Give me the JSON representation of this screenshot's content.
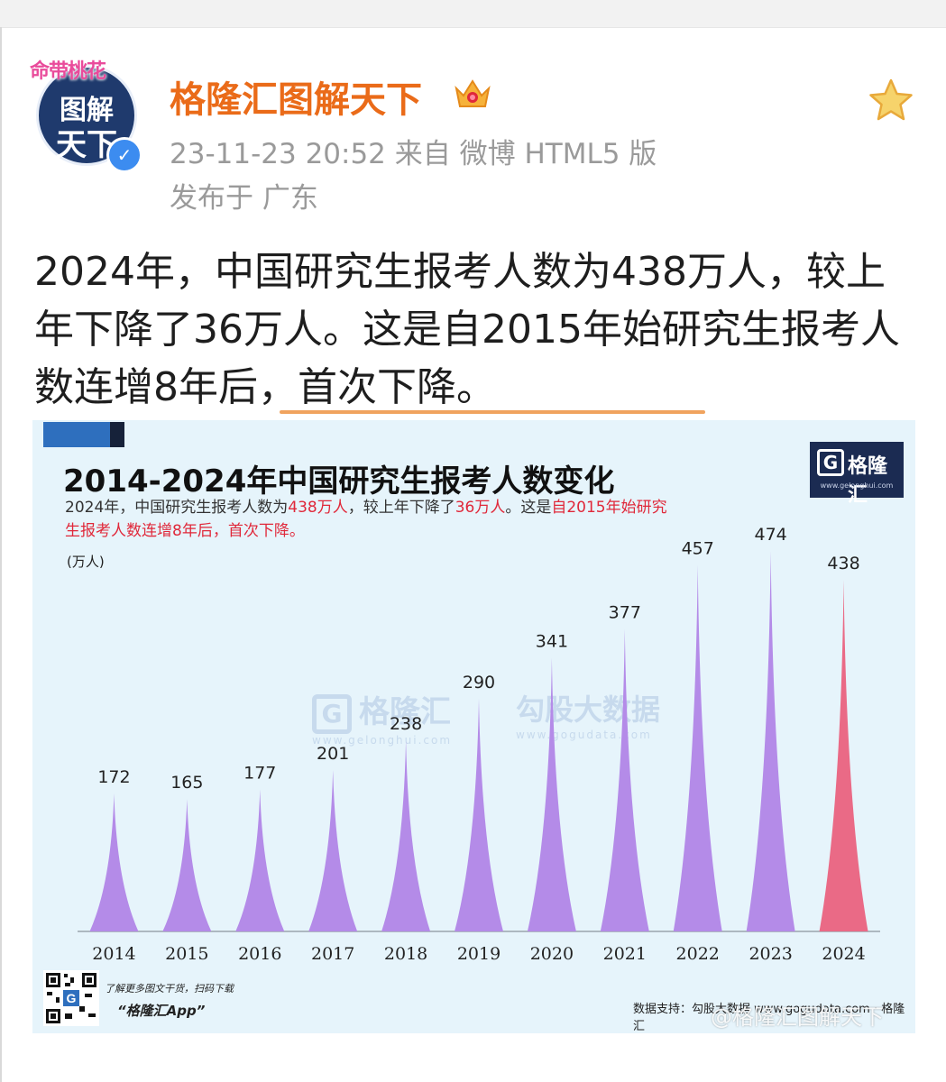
{
  "post": {
    "username": "格隆汇图解天下",
    "avatar_crown": "命带桃花",
    "avatar_line1": "图解",
    "avatar_line2": "天下",
    "verified_mark": "✓",
    "meta_line": "23-11-23 20:52   来自 微博 HTML5 版",
    "location": "发布于 广东",
    "text": "2024年，中国研究生报考人数为438万人，较上年下降了36万人。这是自2015年始研究生报考人数连增8年后，首次下降。"
  },
  "card": {
    "logo_mark": "G",
    "logo_name": "格隆汇",
    "logo_url": "www.gelonghui.com",
    "subtitle_parts": [
      "2024年，中国研究生报考人数为",
      "438万人",
      "，较上年下降了",
      "36万人",
      "。这是",
      "自2015年始研究生报考人数连增8年后，首次下降。"
    ],
    "unit": "(万人)",
    "watermark_left": "格隆汇",
    "watermark_left_url": "www.gelonghui.com",
    "watermark_right": "勾股大数据",
    "watermark_right_url": "www.gogudata.com",
    "qr_line1": "了解更多图文干货，扫码下载",
    "qr_line2": "“格隆汇App”",
    "source": "数据支持：勾股大数据 www.gogudata.com · 格隆汇"
  },
  "weibo_watermark": "@格隆汇图解天下",
  "colors": {
    "accent_orange": "#ea6b19",
    "bar_purple": "#b48be8",
    "bar_highlight": "#ea6a86",
    "highlight_red": "#e0283a"
  },
  "chart_data": {
    "type": "bar",
    "title": "2014-2024年中国研究生报考人数变化",
    "ylabel": "(万人)",
    "categories": [
      "2014",
      "2015",
      "2016",
      "2017",
      "2018",
      "2019",
      "2020",
      "2021",
      "2022",
      "2023",
      "2024"
    ],
    "values": [
      172,
      165,
      177,
      201,
      238,
      290,
      341,
      377,
      457,
      474,
      438
    ],
    "highlight_index": 10,
    "ylim": [
      0,
      500
    ],
    "grid": false,
    "legend": "none"
  }
}
